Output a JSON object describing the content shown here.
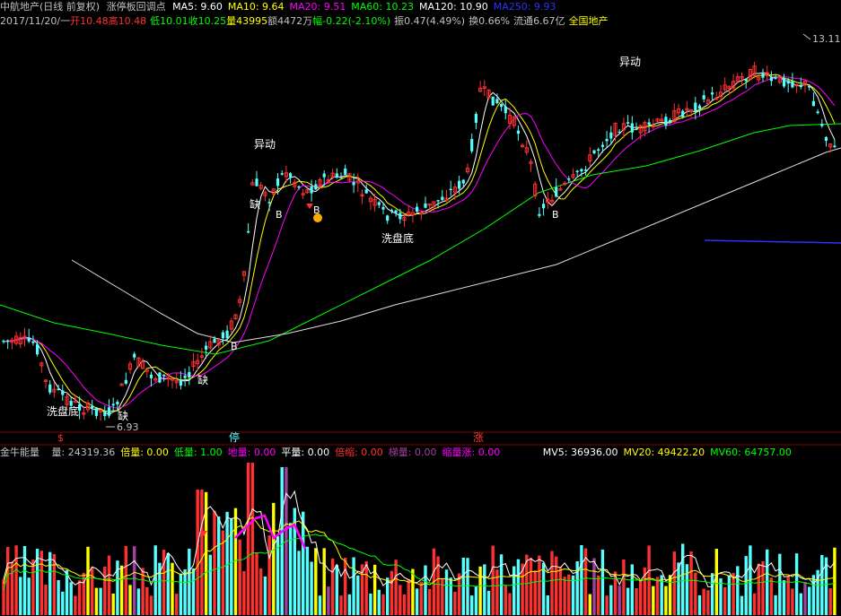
{
  "header": {
    "stock_name": "中航地产",
    "period": "(日线 前复权)",
    "indicator": "涨停板回调点",
    "ma": [
      {
        "label": "MA5:",
        "value": "9.60",
        "color": "#ffffff"
      },
      {
        "label": "MA10:",
        "value": "9.64",
        "color": "#ffff00"
      },
      {
        "label": "MA20:",
        "value": "9.51",
        "color": "#ff00ff"
      },
      {
        "label": "MA60:",
        "value": "10.23",
        "color": "#00ff00"
      },
      {
        "label": "MA120:",
        "value": "10.90",
        "color": "#ffffff"
      },
      {
        "label": "MA250:",
        "value": "9.93",
        "color": "#3030ff"
      }
    ]
  },
  "quote": {
    "date": "2017/11/20/一",
    "open_label": "开",
    "open": "10.48",
    "high_label": "高",
    "high": "10.48",
    "low_label": "低",
    "low": "10.01",
    "close_label": "收",
    "close": "10.25",
    "vol_label": "量",
    "vol": "43995",
    "amt_label": "额",
    "amt": "4472万",
    "chg_label": "幅",
    "chg": "-0.22(-2.10%)",
    "amp_label": "振",
    "amp": "0.47(4.49%)",
    "turn_label": "换",
    "turn": "0.66%",
    "float_label": "流通",
    "float": "6.67亿",
    "sector": "全国地产"
  },
  "annotations": {
    "yidong": "异动",
    "xipandi": "洗盘底",
    "que": "缺",
    "b": "B",
    "price_high": "13.11",
    "price_low": "6.93",
    "ting": "停",
    "zhang": "涨",
    "s": "$"
  },
  "volume_panel": {
    "title": "金牛能量",
    "items": [
      {
        "label": "量:",
        "value": "24319.36",
        "color": "#c0c0c0"
      },
      {
        "label": "倍量:",
        "value": "0.00",
        "color": "#ffff00"
      },
      {
        "label": "低量:",
        "value": "1.00",
        "color": "#00ff00"
      },
      {
        "label": "地量:",
        "value": "0.00",
        "color": "#ff00ff"
      },
      {
        "label": "平量:",
        "value": "0.00",
        "color": "#ffffff"
      },
      {
        "label": "倍缩:",
        "value": "0.00",
        "color": "#ff3030"
      },
      {
        "label": "梯量:",
        "value": "0.00",
        "color": "#a040a0"
      },
      {
        "label": "缩量涨:",
        "value": "0.00",
        "color": "#ff00ff"
      }
    ],
    "mv": [
      {
        "label": "MV5:",
        "value": "36936.00",
        "color": "#ffffff"
      },
      {
        "label": "MV20:",
        "value": "49422.20",
        "color": "#ffff00"
      },
      {
        "label": "MV60:",
        "value": "64757.00",
        "color": "#00ff00"
      }
    ]
  },
  "colors": {
    "up": "#ff3030",
    "down": "#54ffff",
    "bg": "#000000",
    "grid": "#800000"
  }
}
